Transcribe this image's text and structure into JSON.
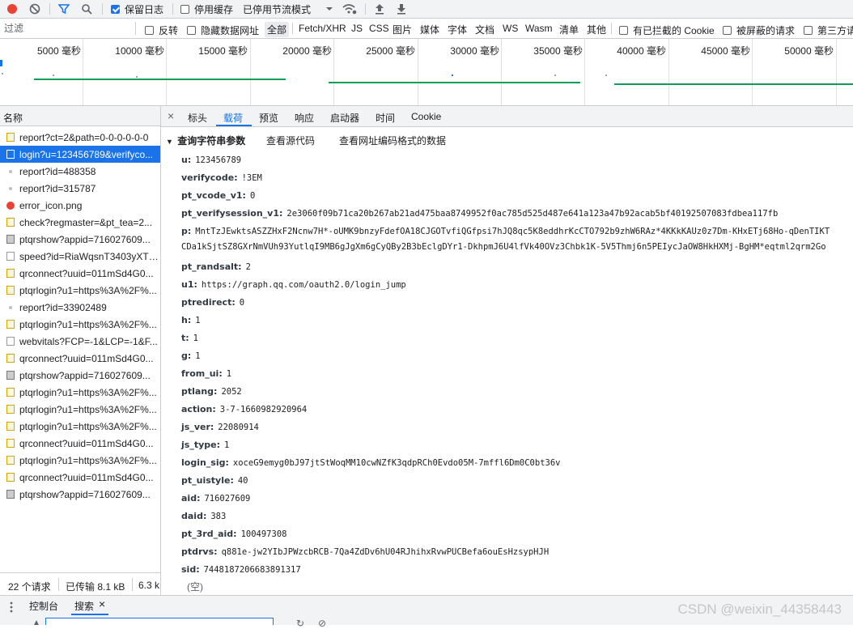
{
  "toolbar": {
    "preserve_log": "保留日志",
    "disable_cache": "停用缓存",
    "throttling": "已停用节流模式"
  },
  "filterbar": {
    "filter_placeholder": "过滤",
    "invert": "反转",
    "hide_data_urls": "隐藏数据网址",
    "types": [
      "全部",
      "Fetch/XHR",
      "JS",
      "CSS",
      "图片",
      "媒体",
      "字体",
      "文档",
      "WS",
      "Wasm",
      "清单",
      "其他"
    ],
    "blocked_cookies": "有已拦截的 Cookie",
    "blocked_requests": "被屏蔽的请求",
    "third_party": "第三方请求"
  },
  "timeline": {
    "ticks": [
      "5000 毫秒",
      "10000 毫秒",
      "15000 毫秒",
      "20000 毫秒",
      "25000 毫秒",
      "30000 毫秒",
      "35000 毫秒",
      "40000 毫秒",
      "45000 毫秒",
      "50000 毫秒"
    ]
  },
  "requests": {
    "header": "名称",
    "items": [
      {
        "name": "report?ct=2&path=0-0-0-0-0-0",
        "type": "xhr"
      },
      {
        "name": "login?u=123456789&verifyco...",
        "type": "doc"
      },
      {
        "name": "report?id=488358",
        "type": "dot"
      },
      {
        "name": "report?id=315787",
        "type": "dot"
      },
      {
        "name": "error_icon.png",
        "type": "err"
      },
      {
        "name": "check?regmaster=&pt_tea=2...",
        "type": "xhr"
      },
      {
        "name": "ptqrshow?appid=716027609...",
        "type": "img"
      },
      {
        "name": "speed?id=RiaWqsnT3403yXTg...",
        "type": "other"
      },
      {
        "name": "qrconnect?uuid=011mSd4G0...",
        "type": "xhr"
      },
      {
        "name": "ptqrlogin?u1=https%3A%2F%...",
        "type": "xhr"
      },
      {
        "name": "report?id=33902489",
        "type": "dot"
      },
      {
        "name": "ptqrlogin?u1=https%3A%2F%...",
        "type": "xhr"
      },
      {
        "name": "webvitals?FCP=-1&LCP=-1&F...",
        "type": "other"
      },
      {
        "name": "qrconnect?uuid=011mSd4G0...",
        "type": "xhr"
      },
      {
        "name": "ptqrshow?appid=716027609...",
        "type": "img"
      },
      {
        "name": "ptqrlogin?u1=https%3A%2F%...",
        "type": "xhr"
      },
      {
        "name": "ptqrlogin?u1=https%3A%2F%...",
        "type": "xhr"
      },
      {
        "name": "ptqrlogin?u1=https%3A%2F%...",
        "type": "xhr"
      },
      {
        "name": "qrconnect?uuid=011mSd4G0...",
        "type": "xhr"
      },
      {
        "name": "ptqrlogin?u1=https%3A%2F%...",
        "type": "xhr"
      },
      {
        "name": "qrconnect?uuid=011mSd4G0...",
        "type": "xhr"
      },
      {
        "name": "ptqrshow?appid=716027609...",
        "type": "img"
      }
    ]
  },
  "status": {
    "requests": "22 个请求",
    "transferred": "已传输 8.1 kB",
    "resources": "6.3 k"
  },
  "detail_tabs": [
    "标头",
    "载荷",
    "预览",
    "响应",
    "启动器",
    "时间",
    "Cookie"
  ],
  "payload": {
    "section_title": "查询字符串参数",
    "view_source": "查看源代码",
    "view_url_encoded": "查看网址编码格式的数据",
    "params": [
      {
        "key": "u:",
        "value": "123456789"
      },
      {
        "key": "verifycode:",
        "value": "!3EM"
      },
      {
        "key": "pt_vcode_v1:",
        "value": "0"
      },
      {
        "key": "pt_verifysession_v1:",
        "value": "2e3060f09b71ca20b267ab21ad475baa8749952f0ac785d525d487e641a123a47b92acab5bf40192507083fdbea117fb"
      },
      {
        "key": "p:",
        "value": "MntTzJEwktsASZZHxF2Ncnw7H*-oUMK9bnzyFdefOA18CJGOTvfiQGfpsi7hJQ8qc5K8eddhrKcCTO792b9zhW6RAz*4KKkKAUz0z7Dm-KHxETj68Ho-qDenTIKT",
        "cont": "CDa1kSjtSZ8GXrNmVUh93YutlqI9MB6gJgXm6gCyQBy2B3bEclgDYr1-DkhpmJ6U4lfVk40OVz3Chbk1K-5V5Thmj6n5PEIycJaOW8HkHXMj-BgHM*eqtml2qrm2Go"
      },
      {
        "key": "pt_randsalt:",
        "value": "2"
      },
      {
        "key": "u1:",
        "value": "https://graph.qq.com/oauth2.0/login_jump"
      },
      {
        "key": "ptredirect:",
        "value": "0"
      },
      {
        "key": "h:",
        "value": "1"
      },
      {
        "key": "t:",
        "value": "1"
      },
      {
        "key": "g:",
        "value": "1"
      },
      {
        "key": "from_ui:",
        "value": "1"
      },
      {
        "key": "ptlang:",
        "value": "2052"
      },
      {
        "key": "action:",
        "value": "3-7-1660982920964"
      },
      {
        "key": "js_ver:",
        "value": "22080914"
      },
      {
        "key": "js_type:",
        "value": "1"
      },
      {
        "key": "login_sig:",
        "value": "xoceG9emyg0bJ97jtStWoqMM10cwNZfK3qdpRCh0Evdo05M-7mffl6Dm0C0bt36v"
      },
      {
        "key": "pt_uistyle:",
        "value": "40"
      },
      {
        "key": "aid:",
        "value": "716027609"
      },
      {
        "key": "daid:",
        "value": "383"
      },
      {
        "key": "pt_3rd_aid:",
        "value": "100497308"
      },
      {
        "key": "ptdrvs:",
        "value": "q881e-jw2YIbJPWzcbRCB-7Qa4ZdDv6hU04RJhihxRvwPUCBefa6ouEsHzsypHJH"
      },
      {
        "key": "sid:",
        "value": "7448187206683891317"
      }
    ],
    "empty": "(空)"
  },
  "drawer": {
    "console_tab": "控制台",
    "search_tab": "搜索"
  },
  "watermark": "CSDN @weixin_44358443",
  "colors": {
    "accent": "#1a73e8",
    "record": "#ea4335",
    "timeline_bar": "#0f9d58"
  }
}
